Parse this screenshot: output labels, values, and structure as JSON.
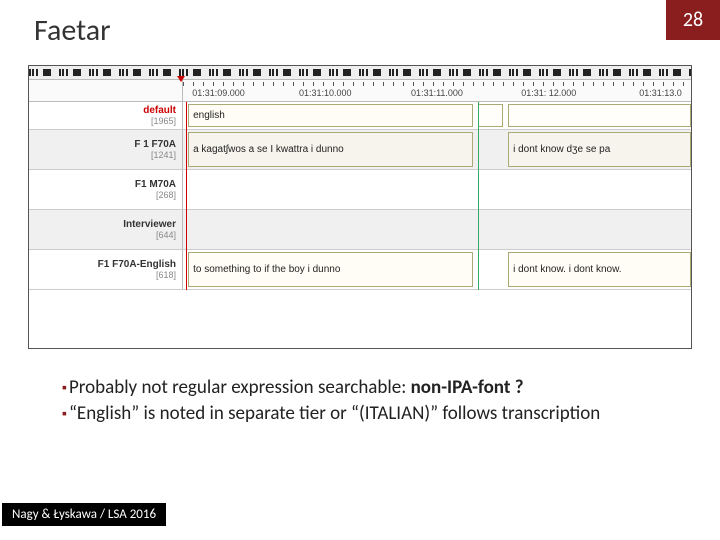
{
  "header": {
    "title": "Faetar",
    "page_number": "28"
  },
  "timeline": {
    "times": [
      "01:31:09.000",
      "01:31:10.000",
      "01:31:11.000",
      "01:31: 12.000",
      "01:31:13.0"
    ],
    "tiers": [
      {
        "name": "default",
        "count": "[1965]",
        "red": true
      },
      {
        "name": "F 1 F70A",
        "count": "[1241]"
      },
      {
        "name": "F1 M70A",
        "count": "[268]"
      },
      {
        "name": "Interviewer",
        "count": "[644]"
      },
      {
        "name": "F1 F70A-English",
        "count": "[618]"
      }
    ],
    "annotations": {
      "default_english": "english",
      "f1f70a_1": "a kagatʃwos a se I kwattra i dunno",
      "f1f70a_2": "i dont know dʒe se pa",
      "intv_1": "to something to if the boy i dunno",
      "intv_2": "i dont know. i dont know."
    }
  },
  "bullets": {
    "b1_pre": "Probably not regular expression searchable: ",
    "b1_bold": "non-IPA-font ?",
    "b2": "“English” is noted in separate tier or “(ITALIAN)” follows transcription"
  },
  "footer": "Nagy & Łyskawa / LSA 2016"
}
